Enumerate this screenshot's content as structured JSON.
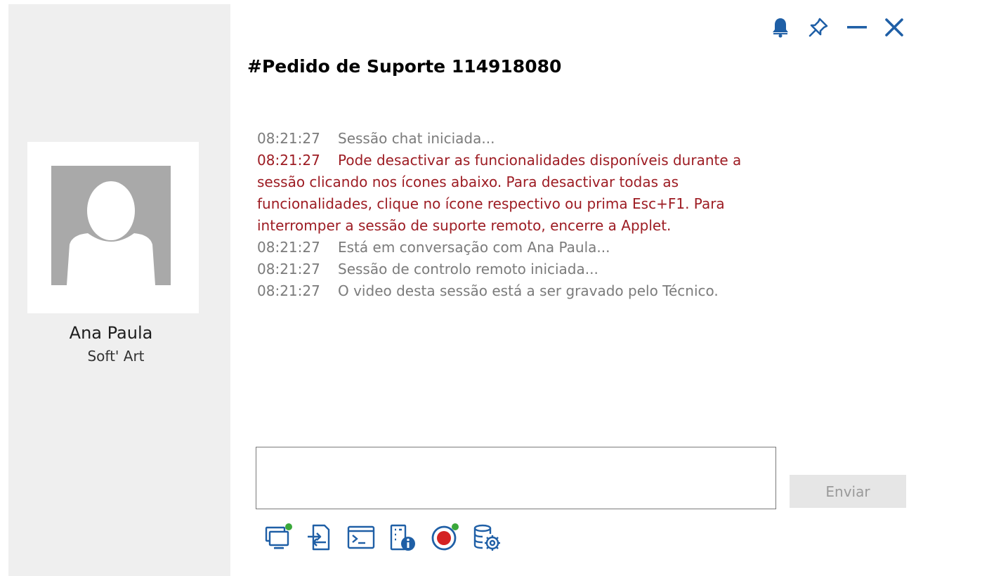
{
  "window": {
    "title": "#Pedido de Suporte 114918080",
    "controls": [
      "bell-icon",
      "pin-icon",
      "minimize-icon",
      "close-icon"
    ],
    "accent_color": "#1f5fa6"
  },
  "contact": {
    "name": "Ana Paula",
    "company": "Soft' Art"
  },
  "chat": {
    "messages": [
      {
        "time": "08:21:27",
        "text": "Sessão chat iniciada...",
        "highlight": false
      },
      {
        "time": "08:21:27",
        "text": "Pode desactivar as funcionalidades disponíveis durante a sessão clicando nos ícones abaixo. Para desactivar todas as funcionalidades, clique no ícone respectivo ou prima Esc+F1. Para interromper a sessão de suporte remoto, encerre a Applet.",
        "highlight": true
      },
      {
        "time": "08:21:27",
        "text": "Está em conversação com Ana Paula...",
        "highlight": false
      },
      {
        "time": "08:21:27",
        "text": "Sessão de controlo remoto iniciada...",
        "highlight": false
      },
      {
        "time": "08:21:27",
        "text": "O video desta sessão está a ser gravado pelo Técnico.",
        "highlight": false
      }
    ],
    "highlight_color": "#9d1c23",
    "normal_color": "#7b7b7b"
  },
  "compose": {
    "value": "",
    "send_label": "Enviar"
  },
  "toolbar": {
    "icons": [
      "remote-screen-icon",
      "file-transfer-icon",
      "terminal-icon",
      "system-info-icon",
      "record-icon",
      "settings-database-icon"
    ],
    "active_indicator_color": "#3aa83a",
    "record_color": "#d42222"
  }
}
